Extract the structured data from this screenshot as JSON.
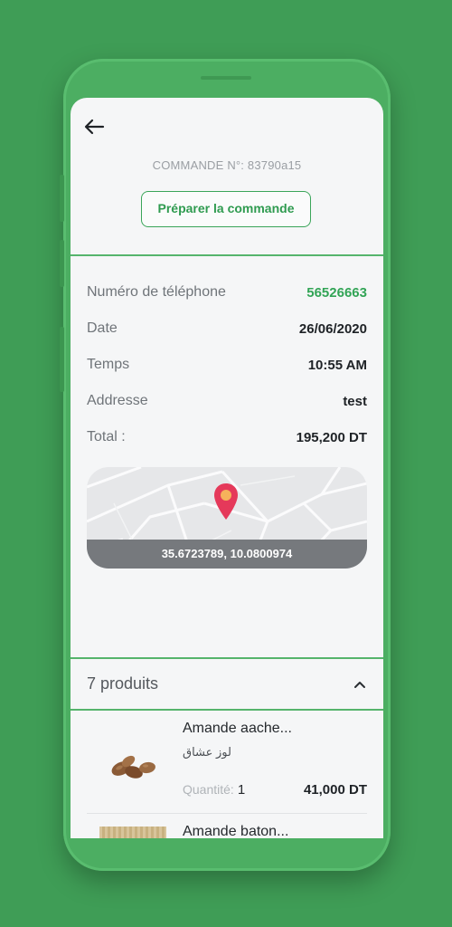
{
  "header": {
    "back_icon": "arrow-left-icon",
    "order_title": "COMMANDE N°: 83790a15",
    "prepare_button": "Préparer la commande"
  },
  "details": {
    "phone_label": "Numéro de téléphone",
    "phone_value": "56526663",
    "date_label": "Date",
    "date_value": "26/06/2020",
    "time_label": "Temps",
    "time_value": "10:55 AM",
    "address_label": "Addresse",
    "address_value": "test",
    "total_label": "Total :",
    "total_value": "195,200 DT"
  },
  "map": {
    "pin_icon": "location-pin-icon",
    "coordinates": "35.6723789, 10.0800974"
  },
  "products": {
    "count_label": "7 produits",
    "toggle_icon": "chevron-up-icon",
    "items": [
      {
        "name": "Amande aache...",
        "name_ar": "لوز عشاق",
        "qty_label": "Quantité:",
        "qty_value": "1",
        "price": "41,000 DT"
      },
      {
        "name": "Amande baton..."
      }
    ]
  },
  "colors": {
    "background": "#3f9d56",
    "phone_frame": "#4cae62",
    "accent_green": "#32a456",
    "pin_red": "#e5395a",
    "pin_yellow": "#f6b25b"
  }
}
